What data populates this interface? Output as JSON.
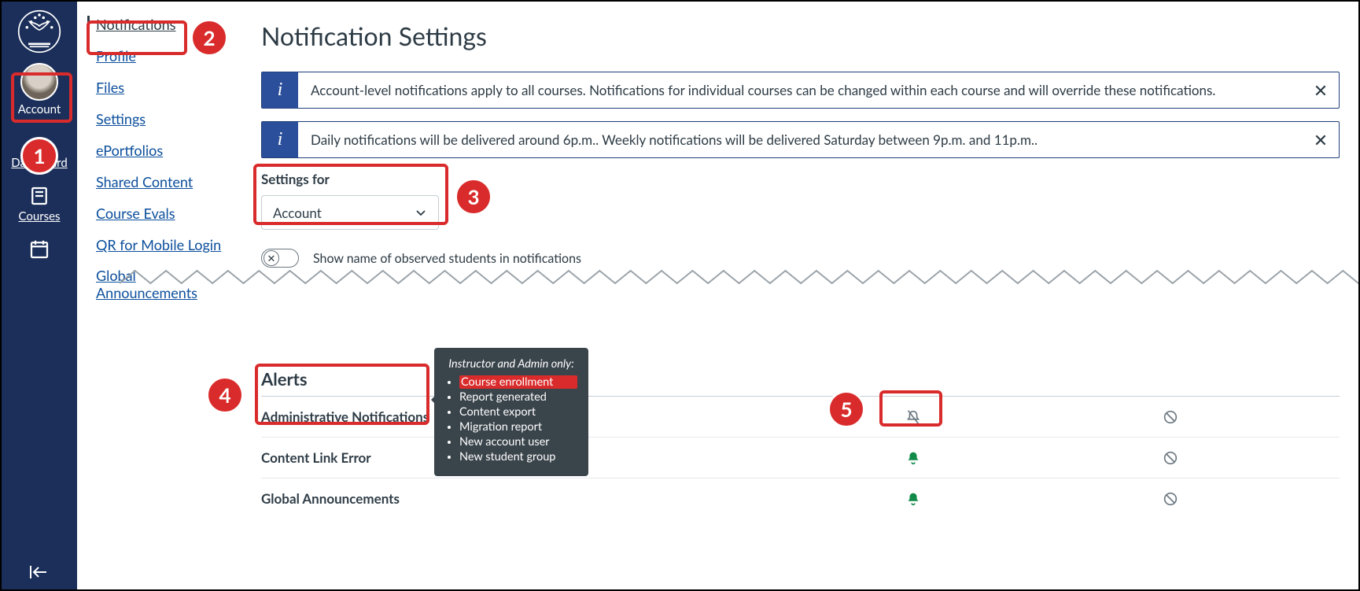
{
  "global_nav": {
    "account": "Account",
    "dashboard": "Dashboard",
    "courses": "Courses"
  },
  "sec_nav": {
    "notifications": "Notifications",
    "profile": "Profile",
    "files": "Files",
    "settings": "Settings",
    "eportfolios": "ePortfolios",
    "shared_content": "Shared Content",
    "course_evals": "Course Evals",
    "qr_login": "QR for Mobile Login",
    "global_announcements": "Global Announcements"
  },
  "page": {
    "title": "Notification Settings",
    "banner1": "Account-level notifications apply to all courses. Notifications for individual courses can be changed within each course and will override these notifications.",
    "banner2": "Daily notifications will be delivered around 6p.m.. Weekly notifications will be delivered Saturday between 9p.m. and 11p.m..",
    "settings_for_label": "Settings for",
    "settings_for_value": "Account",
    "toggle_label": "Show name of observed students in notifications"
  },
  "alerts": {
    "heading": "Alerts",
    "rows": {
      "admin": "Administrative Notifications",
      "content_link_error": "Content Link Error",
      "global_announcements": "Global Announcements"
    }
  },
  "tooltip": {
    "header": "Instructor and Admin only:",
    "items": [
      "Course enrollment",
      "Report generated",
      "Content export",
      "Migration report",
      "New account user",
      "New student group"
    ]
  },
  "annotations": {
    "1": "1",
    "2": "2",
    "3": "3",
    "4": "4",
    "5": "5"
  }
}
